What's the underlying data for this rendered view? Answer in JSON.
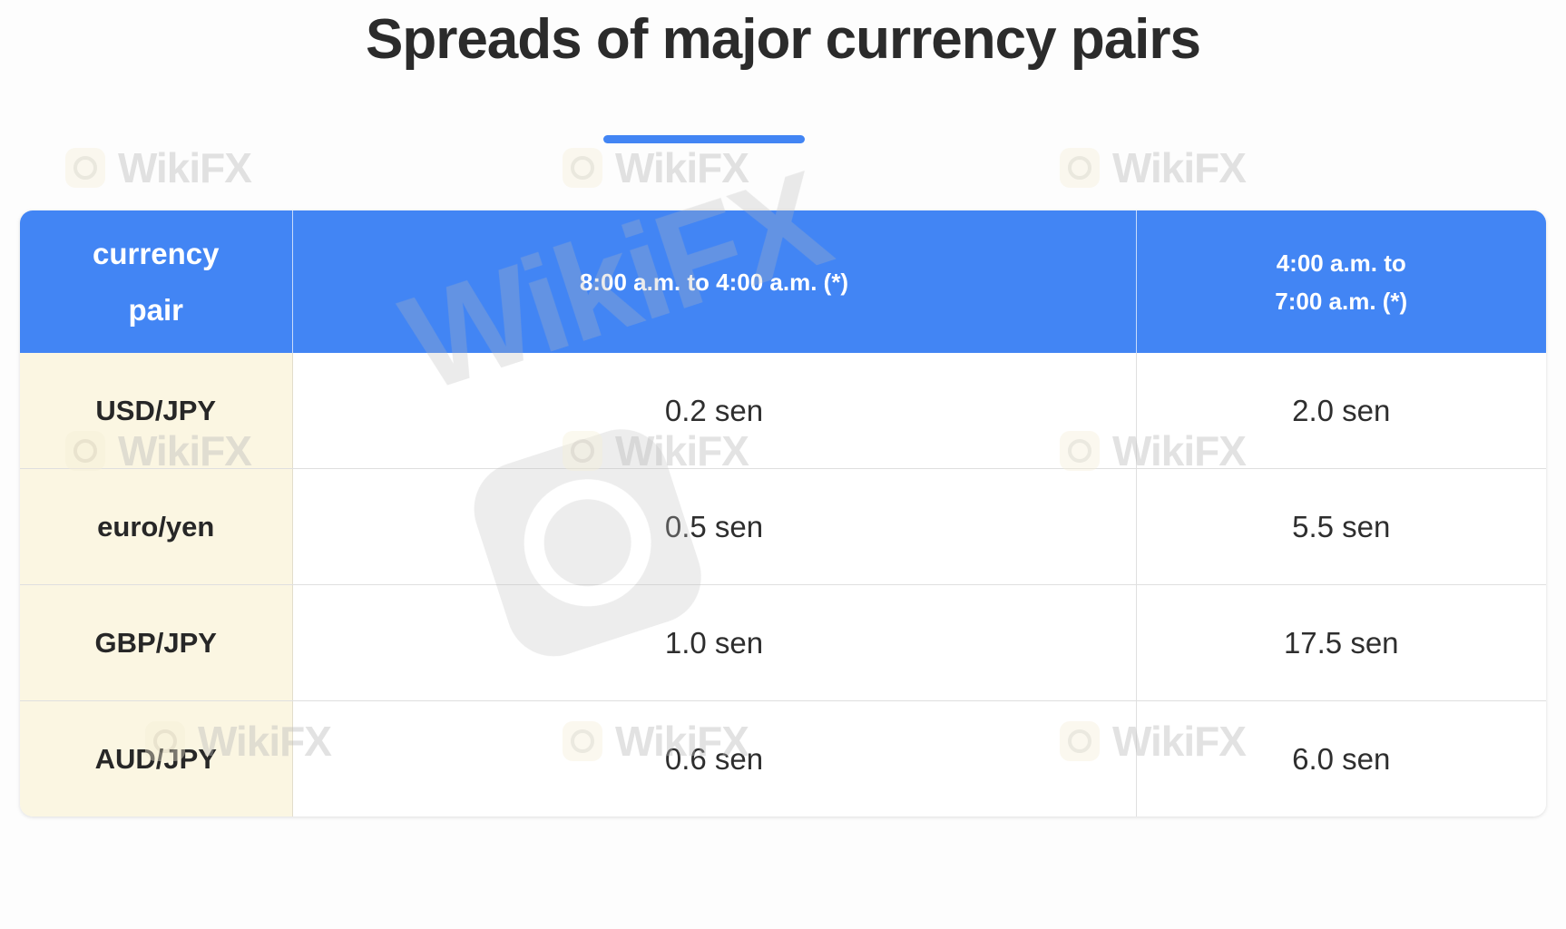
{
  "page": {
    "title": "Spreads of major currency pairs",
    "accent_color": "#4285f4",
    "header_bg": "#4285f4",
    "first_column_bg": "#fbf6e2",
    "text_color": "#2b2b2b"
  },
  "table": {
    "headers": {
      "currency_pair": "currency\npair",
      "currency_pair_line1": "currency",
      "currency_pair_line2": "pair",
      "session_day": "8:00 a.m. to 4:00 a.m. (*)",
      "session_early_line1": "4:00 a.m. to",
      "session_early_line2": "7:00 a.m. (*)"
    },
    "rows": [
      {
        "pair": "USD/JPY",
        "day_spread": "0.2 sen",
        "early_spread": "2.0 sen"
      },
      {
        "pair": "euro/yen",
        "day_spread": "0.5 sen",
        "early_spread": "5.5 sen"
      },
      {
        "pair": "GBP/JPY",
        "day_spread": "1.0 sen",
        "early_spread": "17.5 sen"
      },
      {
        "pair": "AUD/JPY",
        "day_spread": "0.6 sen",
        "early_spread": "6.0 sen"
      }
    ]
  },
  "watermarks": {
    "text": "WikiFX",
    "big_text": "WikiFX",
    "icon": "wikifx-logo-icon"
  }
}
